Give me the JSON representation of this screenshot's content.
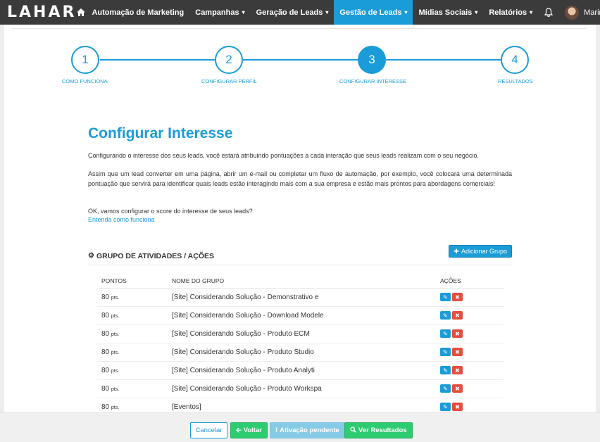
{
  "brand": {
    "logo": "LAHAR"
  },
  "nav": {
    "items": [
      {
        "label": "Automação de Marketing",
        "has_caret": false
      },
      {
        "label": "Campanhas",
        "has_caret": true
      },
      {
        "label": "Geração de Leads",
        "has_caret": true
      },
      {
        "label": "Gestão de Leads",
        "has_caret": true,
        "active": true
      },
      {
        "label": "Mídias Sociais",
        "has_caret": true
      },
      {
        "label": "Relatórios",
        "has_caret": true
      }
    ],
    "user_name": "Marina"
  },
  "wizard": {
    "steps": [
      {
        "number": "1",
        "label": "COMO FUNCIONA"
      },
      {
        "number": "2",
        "label": "CONFIGURAR PERFIL"
      },
      {
        "number": "3",
        "label": "CONFIGURAR INTERESSE",
        "active": true
      },
      {
        "number": "4",
        "label": "RESULTADOS"
      }
    ]
  },
  "main": {
    "title": "Configurar Interesse",
    "paragraphs": [
      "Configurando o interesse dos seus leads, você estará atribuindo pontuações a cada interação que seus leads realizam com o seu negócio.",
      "Assim que um lead converter em uma página, abrir um e-mail ou completar um fluxo de automação, por exemplo, você colocará uma determinada pontuação que servirá para identificar quais leads estão interagindo mais com a sua empresa e estão mais prontos para abordagens comerciais!",
      "OK, vamos configurar o score do interesse de seus leads?"
    ],
    "help_link": "Entenda como funciona"
  },
  "groups": {
    "section_title": "GRUPO DE ATIVIDADES / AÇÕES",
    "add_button": "Adicionar Grupo",
    "columns": [
      "PONTOS",
      "NOME DO GRUPO",
      "AÇÕES"
    ],
    "rows": [
      {
        "points": "80",
        "unit": "pts.",
        "name": "[Site] Considerando Solução - Demonstrativo e"
      },
      {
        "points": "80",
        "unit": "pts.",
        "name": "[Site] Considerando Solução - Download Modele"
      },
      {
        "points": "80",
        "unit": "pts.",
        "name": "[Site] Considerando Solução - Produto ECM"
      },
      {
        "points": "80",
        "unit": "pts.",
        "name": "[Site] Considerando Solução - Produto Studio"
      },
      {
        "points": "80",
        "unit": "pts.",
        "name": "[Site] Considerando Solução - Produto Analyti"
      },
      {
        "points": "80",
        "unit": "pts.",
        "name": "[Site] Considerando Solução - Produto Workspa"
      },
      {
        "points": "80",
        "unit": "pts.",
        "name": "[Eventos]"
      }
    ]
  },
  "footer": {
    "cancel": "Cancelar",
    "back": "Voltar",
    "pending": "Ativação pendente",
    "results": "Ver Resultados"
  },
  "icons": {
    "home": "home-icon",
    "bell": "bell-icon",
    "gear": "gear-icon",
    "plus": "plus-icon",
    "edit": "edit-icon",
    "delete": "delete-icon",
    "arrow_left": "arrow-left-icon",
    "alert": "exclamation-icon",
    "search": "search-icon"
  },
  "colors": {
    "accent": "#1a9cd8",
    "navbar": "#3b3b3b",
    "success": "#2ecc71",
    "danger": "#e74c3c",
    "disabled": "#86cbe6"
  }
}
